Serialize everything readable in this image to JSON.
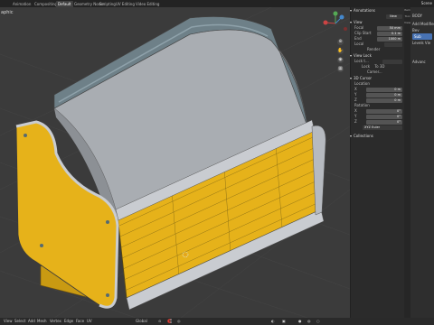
{
  "topbar": {
    "tabs": [
      "Animation",
      "Compositing",
      "Default",
      "Geometry Nodes",
      "Scripting",
      "UV Editing",
      "Video Editing"
    ],
    "active_tab": "Default",
    "scene": "Scene"
  },
  "viewport": {
    "title": "aphic"
  },
  "npanel": {
    "annotations_header": "Annotations",
    "annotations_new": "New",
    "view_header": "View",
    "focal_label": "Focal",
    "focal_value": "50 mm",
    "clip_start_label": "Clip Start",
    "clip_start_value": "0.1 m",
    "end_label": "End",
    "end_value": "1000 m",
    "local_label": "Local",
    "render_label": "Render",
    "view_lock_header": "View Lock",
    "lock_to_obj_label": "Lock t...",
    "lock_label": "Lock",
    "lock_to_3d": "To 3D",
    "camera_label": "Camer...",
    "cursor_header": "3D Cursor",
    "location_label": "Location",
    "loc": [
      {
        "axis": "X",
        "value": "0 m"
      },
      {
        "axis": "Y",
        "value": "0 m"
      },
      {
        "axis": "Z",
        "value": "0 m"
      }
    ],
    "rotation_label": "Rotation",
    "rot": [
      {
        "axis": "X",
        "value": "0°"
      },
      {
        "axis": "Y",
        "value": "0°"
      },
      {
        "axis": "Z",
        "value": "0°"
      }
    ],
    "rot_mode": "XYZ Euler",
    "collections_header": "Collections"
  },
  "vtabs": [
    "Item",
    "Tool",
    "View"
  ],
  "props": {
    "object": "BODY",
    "add_modifier": "Add Modifier",
    "mod1": "Bev",
    "mod2": "Sub",
    "levels": "Levels Vie",
    "advanced": "Advanc"
  },
  "bottombar": {
    "menus": [
      "View",
      "Select",
      "Add",
      "Mesh",
      "Vertex",
      "Edge",
      "Face",
      "UV"
    ],
    "orientation": "Global"
  },
  "colors": {
    "accent": "#4772b3",
    "yellow": "#e6b21a",
    "gray_shell": "#a9adb2"
  }
}
